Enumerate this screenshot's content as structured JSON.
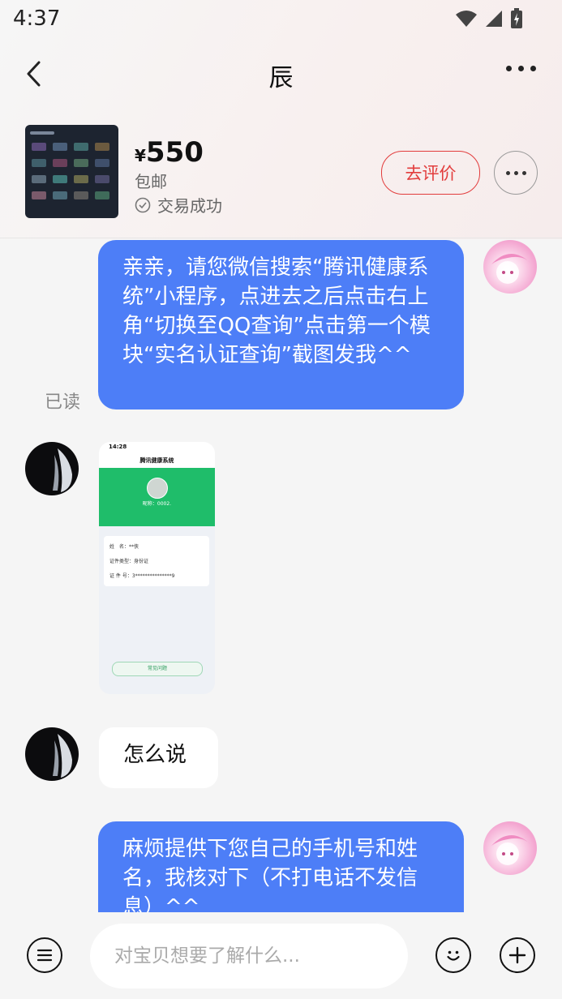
{
  "status_bar": {
    "time": "4:37"
  },
  "header": {
    "title": "辰"
  },
  "product": {
    "currency": "¥",
    "price": "550",
    "shipping": "包邮",
    "deal_status": "交易成功",
    "review_button": "去评价"
  },
  "messages": {
    "m1": "亲亲，请您微信搜索“腾讯健康系统”小程序，点进去之后点击右上角“切换至QQ查询”点击第一个模块“实名认证查询”截图发我^^",
    "m1_status": "已读",
    "m2_image": {
      "time": "14:28",
      "title": "腾讯健康系统",
      "nickname": "昵称：0002.",
      "fields": [
        "姓　名：**侠",
        "证件类型：身份证",
        "证 件 号：3***************9"
      ],
      "button": "常见问题"
    },
    "m3": "怎么说",
    "m4": "麻烦提供下您自己的手机号和姓名，我核对下（不打电话不发信息）^^"
  },
  "input_bar": {
    "placeholder": "对宝贝想要了解什么..."
  }
}
